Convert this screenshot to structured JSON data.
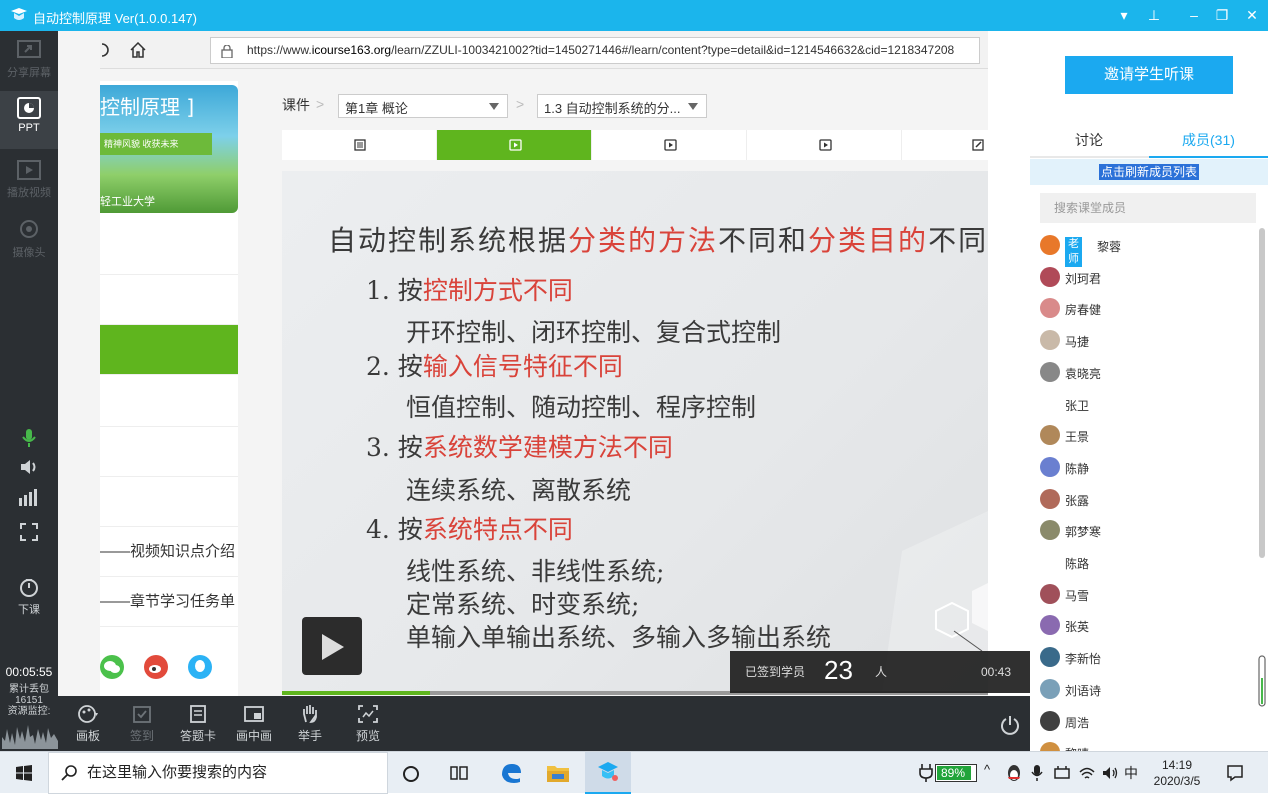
{
  "window": {
    "title": "自动控制原理 Ver(1.0.0.147)",
    "controls": [
      "▾",
      "⊥",
      "–",
      "❐",
      "✕"
    ]
  },
  "left_rail": {
    "items": [
      {
        "label": "分享屏幕",
        "icon": "share-screen-icon",
        "state": "disabled"
      },
      {
        "label": "PPT",
        "icon": "ppt-icon",
        "state": "active"
      },
      {
        "label": "播放视频",
        "icon": "play-video-icon",
        "state": "disabled"
      },
      {
        "label": "摄像头",
        "icon": "camera-icon",
        "state": "disabled"
      }
    ],
    "end_class_label": "下课",
    "timer": "00:05:55",
    "packet_loss_label": "累计丢包",
    "packet_loss_value": "16151",
    "resource_monitor": "资源监控:"
  },
  "browser": {
    "url_prefix": "https://www.",
    "url_domain": "icourse163.org",
    "url_rest": "/learn/ZZULI-1003421002?tid=1450271446#/learn/content?type=detail&id=1214546632&cid=1218347208"
  },
  "course_panel": {
    "title": "控制原理 ]",
    "motto": "精神风貌  收获未来",
    "school": "轻工业大学",
    "rows": [
      "",
      "",
      "",
      "",
      "",
      "",
      "——视频知识点介绍",
      "——章节学习任务单"
    ]
  },
  "content": {
    "breadcrumb_root": "课件",
    "chapter": "第1章 概论",
    "section": "1.3 自动控制系统的分...",
    "tabs": [
      "document",
      "video",
      "video",
      "video",
      "edit"
    ]
  },
  "slide": {
    "heading_parts": [
      "自动控制系统根据",
      "分类的方法",
      "不同和",
      "分类目的",
      "不同."
    ],
    "items": [
      {
        "num": "1. 按",
        "red": "控制方式不同",
        "subs": [
          "开环控制、闭环控制、复合式控制"
        ]
      },
      {
        "num": "2. 按",
        "red": "输入信号特征不同",
        "subs": [
          "恒值控制、随动控制、程序控制"
        ]
      },
      {
        "num": "3. 按",
        "red": "系统数学建模方法不同",
        "subs": [
          "连续系统、离散系统"
        ]
      },
      {
        "num": "4. 按",
        "red": "系统特点不同",
        "subs": [
          "线性系统、非线性系统;",
          "定常系统、时变系统;",
          "单输入单输出系统、多输入多输出系统"
        ]
      }
    ],
    "progress_fraction": 0.21
  },
  "signin": {
    "label": "已签到学员",
    "count": "23",
    "unit": "人",
    "time": "00:43"
  },
  "bottom_toolbar": [
    {
      "label": "画板",
      "icon": "palette-icon",
      "enabled": true
    },
    {
      "label": "签到",
      "icon": "checkin-icon",
      "enabled": false
    },
    {
      "label": "答题卡",
      "icon": "answer-card-icon",
      "enabled": true
    },
    {
      "label": "画中画",
      "icon": "pip-icon",
      "enabled": true
    },
    {
      "label": "举手",
      "icon": "raise-hand-icon",
      "enabled": true
    },
    {
      "label": "预览",
      "icon": "preview-icon",
      "enabled": true
    }
  ],
  "right_panel": {
    "invite_button": "邀请学生听课",
    "tab_discuss": "讨论",
    "tab_members": "成员(31)",
    "refresh_link": "点击刷新成员列表",
    "search_placeholder": "搜索课堂成员",
    "teacher_badge": "老师",
    "members": [
      "黎蓉",
      "刘珂君",
      "房春健",
      "马捷",
      "袁晓亮",
      "张卫",
      "王景",
      "陈静",
      "张露",
      "郭梦寒",
      "陈路",
      "马雪",
      "张英",
      "李新怡",
      "刘语诗",
      "周浩",
      "黎晴"
    ],
    "avatar_colors": [
      "#e8782a",
      "#b04a58",
      "#d98a8a",
      "#c9b9a8",
      "#888888",
      "#ffffff",
      "#b0885a",
      "#6a7fd0",
      "#b06a5a",
      "#8a8a6a",
      "#ffffff",
      "#a0505a",
      "#8a6ab0",
      "#3a6a8a",
      "#7aa0b8",
      "#404040",
      "#d09040"
    ]
  },
  "taskbar": {
    "search_placeholder": "在这里输入你要搜索的内容",
    "battery": "89%",
    "ime": "中",
    "time": "14:19",
    "date": "2020/3/5"
  }
}
